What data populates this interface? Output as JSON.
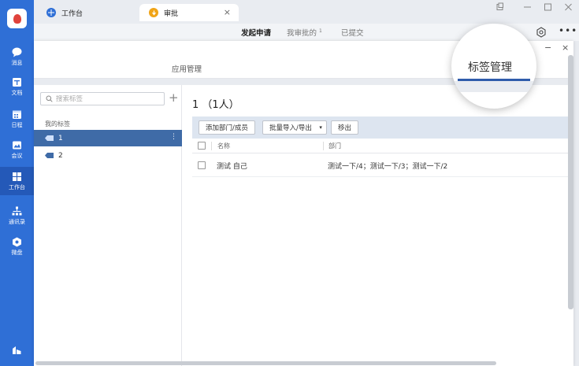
{
  "rail": {
    "items": [
      {
        "label": "消息",
        "icon": "chat-bubble-icon"
      },
      {
        "label": "文档",
        "icon": "document-icon"
      },
      {
        "label": "日程",
        "icon": "calendar-icon"
      },
      {
        "label": "会议",
        "icon": "meeting-icon"
      },
      {
        "label": "工作台",
        "icon": "grid-icon",
        "active": true
      },
      {
        "label": "通讯录",
        "icon": "org-chart-icon"
      },
      {
        "label": "微盘",
        "icon": "disk-icon"
      }
    ]
  },
  "titlebar": {
    "tabs": [
      {
        "label": "工作台",
        "icon": "workbench-icon"
      },
      {
        "label": "审批",
        "icon": "approval-icon",
        "active": true
      }
    ],
    "close_glyph": "×"
  },
  "subheader": {
    "tabs": [
      {
        "label": "发起申请",
        "active": true
      },
      {
        "label": "我审批的",
        "badge": "1"
      },
      {
        "label": "已提交"
      }
    ],
    "more_glyph": "•••"
  },
  "modal": {
    "tab_app_manage": "应用管理",
    "tab_tag_manage": "标签管理",
    "min_glyph": "−",
    "close_glyph": "×"
  },
  "left_panel": {
    "search_placeholder": "搜索标签",
    "add_glyph": "+",
    "section_title": "我的标签",
    "tags": [
      {
        "label": "1",
        "active": true
      },
      {
        "label": "2"
      }
    ],
    "more_glyph": "⋮"
  },
  "right_panel": {
    "title": "1 （1人）",
    "buttons": {
      "add": "添加部门/成员",
      "batch": "批量导入/导出",
      "batch_caret": "▾",
      "remove": "移出"
    },
    "columns": {
      "name": "名称",
      "dept": "部门"
    },
    "rows": [
      {
        "name": "测试 自己",
        "dept": "测试一下/4；测试一下/3；测试一下/2"
      }
    ]
  },
  "colors": {
    "rail": "#2f6fd6",
    "active_tag": "#3f6ba7",
    "toolbar": "#dde5f0",
    "accent_bar": "#2f5cab"
  }
}
